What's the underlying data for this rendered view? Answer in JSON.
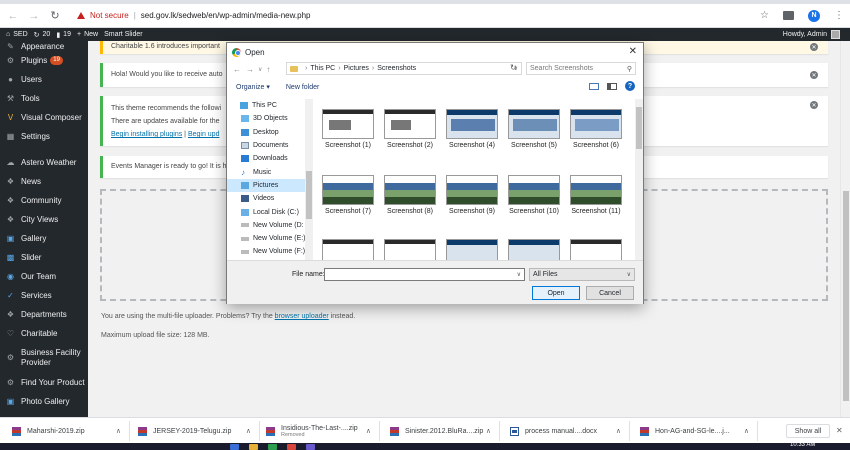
{
  "browser": {
    "nav_back_icon": "arrow-left-icon",
    "nav_forward_icon": "arrow-right-icon",
    "reload_icon": "reload-icon",
    "security_label": "Not secure",
    "url": "sed.gov.lk/sedweb/en/wp-admin/media-new.php",
    "profile_initial": "N"
  },
  "adminbar": {
    "site_name": "SED",
    "updates_count": "20",
    "comments_count": "19",
    "new_label": "New",
    "smart_slider_label": "Smart Slider",
    "howdy": "Howdy, Admin"
  },
  "sidebar": {
    "items": [
      {
        "label": "Appearance",
        "icon": "paintbrush-icon"
      },
      {
        "label": "Plugins",
        "icon": "plugin-icon",
        "badge": "19"
      },
      {
        "label": "Users",
        "icon": "users-icon"
      },
      {
        "label": "Tools",
        "icon": "wrench-icon"
      },
      {
        "label": "Visual Composer",
        "icon": "vc-icon"
      },
      {
        "label": "Settings",
        "icon": "settings-icon"
      },
      {
        "label": "Astero Weather",
        "icon": "cloud-icon"
      },
      {
        "label": "News",
        "icon": "pin-icon"
      },
      {
        "label": "Community",
        "icon": "pin-icon"
      },
      {
        "label": "City Views",
        "icon": "pin-icon"
      },
      {
        "label": "Gallery",
        "icon": "gallery-icon"
      },
      {
        "label": "Slider",
        "icon": "slider-icon"
      },
      {
        "label": "Our Team",
        "icon": "team-icon"
      },
      {
        "label": "Services",
        "icon": "check-icon"
      },
      {
        "label": "Departments",
        "icon": "pin-icon"
      },
      {
        "label": "Charitable",
        "icon": "charitable-icon"
      },
      {
        "label": "Business Facility Provider",
        "icon": "gear-icon"
      },
      {
        "label": "Find Your Product",
        "icon": "gear-icon"
      },
      {
        "label": "Photo Gallery",
        "icon": "photo-icon"
      }
    ]
  },
  "notices": {
    "charitable": "Charitable 1.6 introduces important",
    "hola": "Hola! Would you like to receive auto",
    "theme_line1": "This theme recommends the followi",
    "theme_line2": "There are updates available for the",
    "install_link": "Begin installing plugins",
    "link_sep": " | ",
    "update_link": "Begin upd",
    "events": "Events Manager is ready to go! It is h"
  },
  "uploader": {
    "prefix": "You are using the multi-file uploader. Problems? Try the ",
    "link": "browser uploader",
    "suffix": " instead.",
    "max_size": "Maximum upload file size: 128 MB."
  },
  "dialog": {
    "title": "Open",
    "breadcrumb": [
      "This PC",
      "Pictures",
      "Screenshots"
    ],
    "search_placeholder": "Search Screenshots",
    "organize": "Organize ▾",
    "new_folder": "New folder",
    "nav_items": [
      {
        "label": "This PC",
        "icon": "pc-icon"
      },
      {
        "label": "3D Objects",
        "icon": "cube-icon"
      },
      {
        "label": "Desktop",
        "icon": "desktop-icon"
      },
      {
        "label": "Documents",
        "icon": "documents-icon"
      },
      {
        "label": "Downloads",
        "icon": "downloads-icon"
      },
      {
        "label": "Music",
        "icon": "music-icon"
      },
      {
        "label": "Pictures",
        "icon": "pictures-icon"
      },
      {
        "label": "Videos",
        "icon": "videos-icon"
      },
      {
        "label": "Local Disk (C:)",
        "icon": "disk-icon"
      },
      {
        "label": "New Volume (D:",
        "icon": "drive-icon"
      },
      {
        "label": "New Volume (E:)",
        "icon": "drive-icon"
      },
      {
        "label": "New Volume (F:)",
        "icon": "drive-icon"
      }
    ],
    "files": [
      "Screenshot (1)",
      "Screenshot (2)",
      "Screenshot (4)",
      "Screenshot (5)",
      "Screenshot (6)",
      "Screenshot (7)",
      "Screenshot (8)",
      "Screenshot (9)",
      "Screenshot (10)",
      "Screenshot (11)"
    ],
    "file_name_label": "File name:",
    "file_name_value": "",
    "filter_value": "All Files",
    "open_button": "Open",
    "cancel_button": "Cancel"
  },
  "downloads": {
    "items": [
      {
        "name": "Maharshi-2019.zip",
        "sub": ""
      },
      {
        "name": "JERSEY-2019-Telugu.zip",
        "sub": ""
      },
      {
        "name": "Insidious-The-Last-....zip",
        "sub": "Removed"
      },
      {
        "name": "Sinister.2012.BluRa....zip",
        "sub": ""
      },
      {
        "name": "process manual....docx",
        "sub": ""
      },
      {
        "name": "Hon-AG-and-SG-le....j...",
        "sub": ""
      }
    ],
    "show_all": "Show all"
  },
  "taskbar": {
    "time": "10:33 AM"
  }
}
